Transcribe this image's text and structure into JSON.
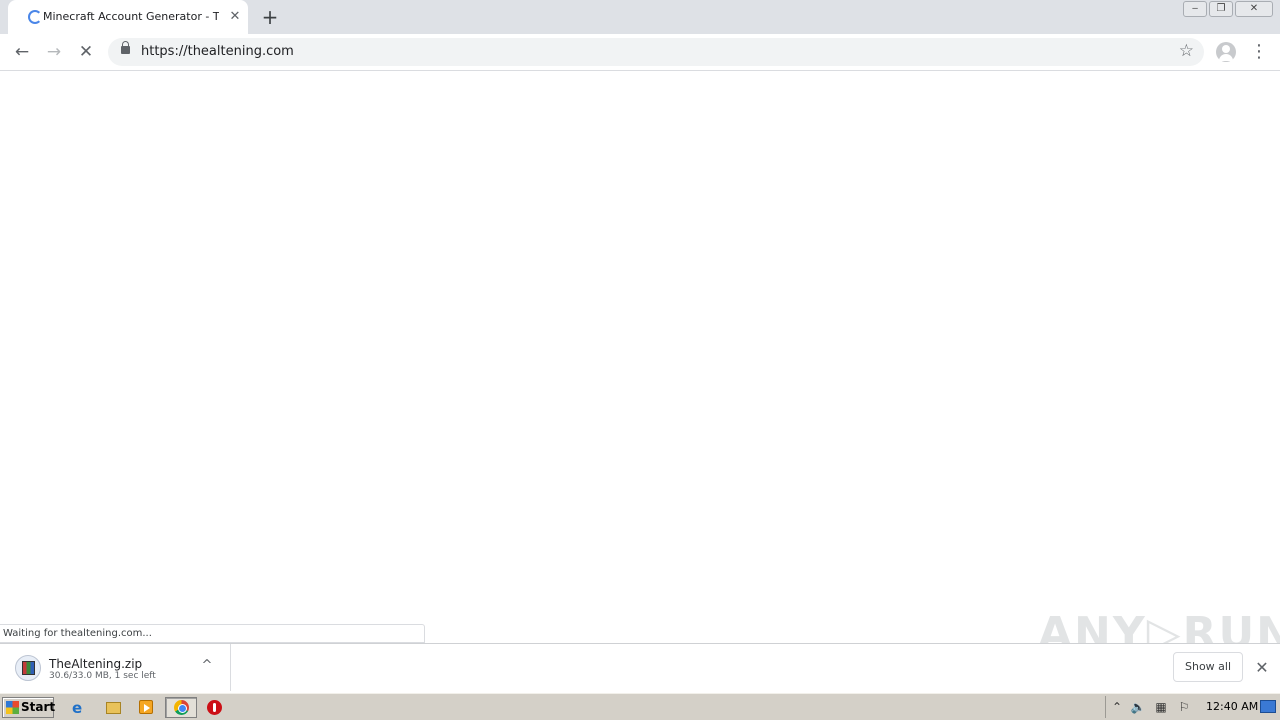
{
  "browser": {
    "tab": {
      "title": "Minecraft Account Generator - TheAltening"
    },
    "new_tab_symbol": "+",
    "window_controls": {
      "minimize": "‒",
      "restore": "❐",
      "close": "✕"
    },
    "toolbar": {
      "back_symbol": "←",
      "forward_symbol": "→",
      "stop_symbol": "✕",
      "url": "https://thealtening.com",
      "bookmark_symbol": "☆",
      "menu_symbol": "⋮"
    },
    "status_text": "Waiting for thealtening.com..."
  },
  "download_shelf": {
    "item": {
      "filename": "TheAltening.zip",
      "status": "30.6/33.0 MB, 1 sec left",
      "chevron": "^"
    },
    "show_all_label": "Show all",
    "close_symbol": "✕"
  },
  "watermark": "ANY▷RUN",
  "taskbar": {
    "start_label": "Start",
    "ie_symbol": "e",
    "tray": {
      "chevron": "⌃",
      "volume": "🔈",
      "network": "▦",
      "flag": "⚐",
      "clock": "12:40 AM"
    }
  }
}
